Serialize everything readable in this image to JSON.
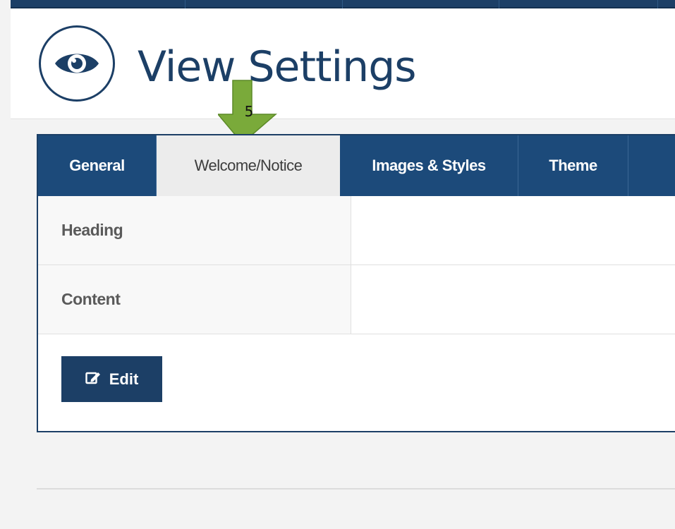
{
  "header": {
    "title": "View Settings",
    "icon": "eye-icon"
  },
  "annotation": {
    "label": "5",
    "color": "#7aaa3a"
  },
  "tabs": [
    {
      "label": "General",
      "active": false
    },
    {
      "label": "Welcome/Notice",
      "active": true
    },
    {
      "label": "Images & Styles",
      "active": false
    },
    {
      "label": "Theme",
      "active": false
    }
  ],
  "rows": [
    {
      "label": "Heading",
      "value": ""
    },
    {
      "label": "Content",
      "value": ""
    }
  ],
  "actions": {
    "edit_label": "Edit",
    "edit_icon": "edit-icon"
  },
  "colors": {
    "navy": "#1c3f66",
    "tab_bar": "#1c4a7a",
    "active_tab": "#ececec",
    "page_bg": "#f3f3f3"
  }
}
